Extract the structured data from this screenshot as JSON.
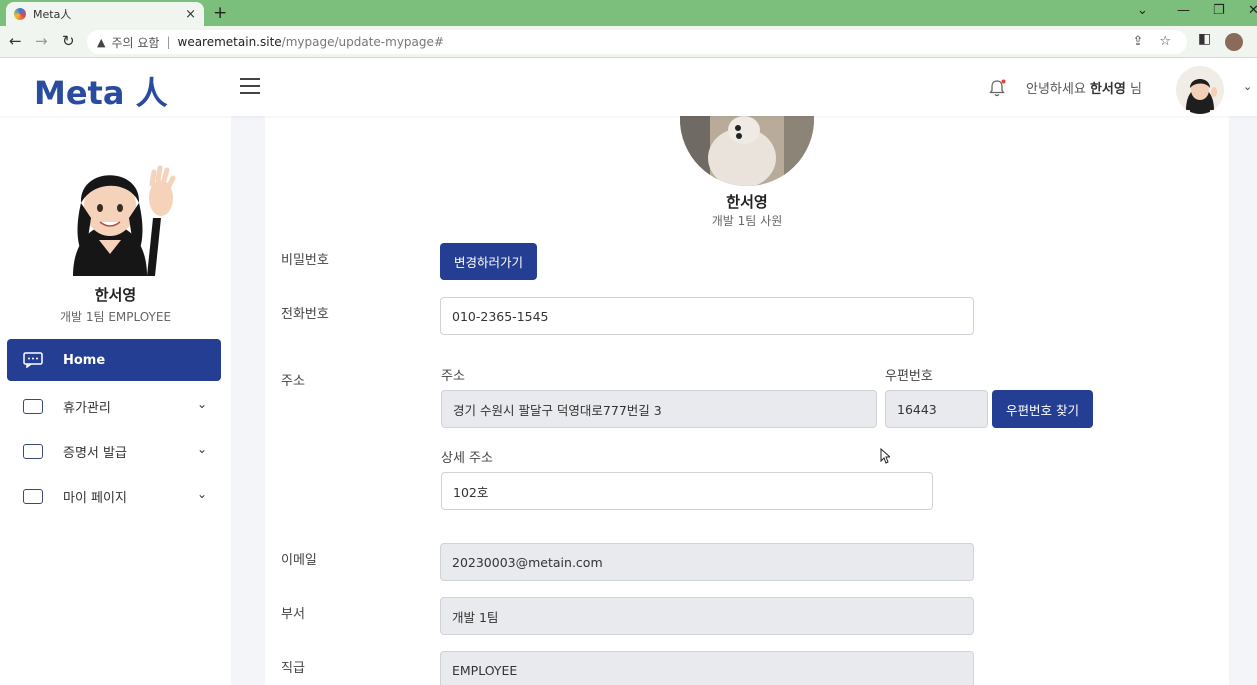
{
  "browser": {
    "tab_title": "Meta人",
    "tab_close": "×",
    "new_tab": "+",
    "security_label": "주의 요함",
    "url_host": "wearemetain.site",
    "url_path": "/mypage/update-mypage#"
  },
  "header": {
    "logo": "Meta 人",
    "greeting_prefix": "안녕하세요",
    "user_name": "한서영",
    "greeting_suffix": "님"
  },
  "sidebar": {
    "name": "한서영",
    "role": "개발 1팀 EMPLOYEE",
    "items": [
      {
        "label": "Home",
        "active": true
      },
      {
        "label": "휴가관리",
        "expandable": true
      },
      {
        "label": "증명서 발급",
        "expandable": true
      },
      {
        "label": "마이 페이지",
        "expandable": true
      }
    ]
  },
  "profile": {
    "name": "한서영",
    "dept": "개발 1팀 사원"
  },
  "form": {
    "password_label": "비밀번호",
    "password_button": "변경하러가기",
    "phone_label": "전화번호",
    "phone_value": "010-2365-1545",
    "address_label": "주소",
    "address_sub_label": "주소",
    "address_value": "경기 수원시 팔달구 덕영대로777번길 3",
    "zip_label": "우편번호",
    "zip_value": "16443",
    "zip_button": "우편번호 찾기",
    "detail_label": "상세 주소",
    "detail_value": "102호",
    "email_label": "이메일",
    "email_value": "20230003@metain.com",
    "dept_label": "부서",
    "dept_value": "개발 1팀",
    "rank_label": "직급",
    "rank_value": "EMPLOYEE"
  },
  "colors": {
    "brand": "#233e93",
    "logo": "#2a4c9e",
    "chrome_green": "#7cbf7c"
  }
}
